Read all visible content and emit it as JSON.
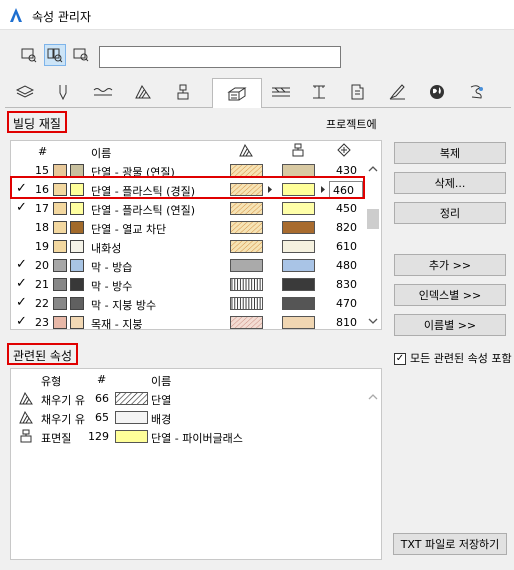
{
  "window": {
    "title": "속성 관리자"
  },
  "search": {
    "value": ""
  },
  "section1": {
    "label": "빌딩 재질",
    "right_label": "프로젝트에"
  },
  "list_headers": {
    "num": "#",
    "name": "이름"
  },
  "materials": [
    {
      "num": "15",
      "name": "단열 - 광물 (연질)",
      "checked": false,
      "sw1": "#e8c99a",
      "sw2": "#c8c09e",
      "pattern": "hatch-orange",
      "color": "#d8c9a2",
      "value": "430"
    },
    {
      "num": "16",
      "name": "단열 - 플라스틱 (경질)",
      "checked": true,
      "sw1": "#f3d8a0",
      "sw2": "#ffff99",
      "pattern": "hatch-orange",
      "color": "#ffff99",
      "value": "460",
      "selected": true
    },
    {
      "num": "17",
      "name": "단열 - 플라스틱 (연질)",
      "checked": true,
      "sw1": "#f3d8a0",
      "sw2": "#ffffa0",
      "pattern": "hatch-orange",
      "color": "#ffffa8",
      "value": "450"
    },
    {
      "num": "18",
      "name": "단열 - 열교 차단",
      "checked": false,
      "sw1": "#f3d8a0",
      "sw2": "#a26a2a",
      "pattern": "hatch-orange",
      "color": "#a86b2e",
      "value": "820"
    },
    {
      "num": "19",
      "name": "내화성",
      "checked": false,
      "sw1": "#f3d8a0",
      "sw2": "#f5f3e8",
      "pattern": "hatch-orange",
      "color": "#f5f1df",
      "value": "610"
    },
    {
      "num": "20",
      "name": "막 - 방습",
      "checked": true,
      "sw1": "#a8a8a8",
      "sw2": "#a8c4e4",
      "pattern": "solid-gray",
      "color": "#a9c4e6",
      "value": "480"
    },
    {
      "num": "21",
      "name": "막 - 방수",
      "checked": true,
      "sw1": "#888888",
      "sw2": "#383838",
      "pattern": "vlines",
      "color": "#3a3a3a",
      "value": "830"
    },
    {
      "num": "22",
      "name": "막 - 지붕 방수",
      "checked": true,
      "sw1": "#888888",
      "sw2": "#606060",
      "pattern": "vlines",
      "color": "#555555",
      "value": "470"
    },
    {
      "num": "23",
      "name": "목재 - 지붕",
      "checked": true,
      "sw1": "#e8b8a8",
      "sw2": "#f2d8b4",
      "pattern": "hatch-pink",
      "color": "#f0d6b2",
      "value": "810"
    }
  ],
  "buttons": {
    "duplicate": "복제",
    "delete": "삭제...",
    "cleanup": "정리",
    "add": "추가 >>",
    "by_index": "인덱스별 >>",
    "by_name": "이름별 >>",
    "save_txt": "TXT 파일로 저장하기"
  },
  "section2": {
    "label": "관련된 속성",
    "checkbox_label": "모든 관련된 속성 포함",
    "checkbox_checked": true
  },
  "related_headers": {
    "type": "유형",
    "num": "#",
    "name": "이름"
  },
  "related": [
    {
      "type": "채우기 유",
      "num": "66",
      "name": "단열",
      "icon": "fill-icon",
      "swatch": "hatch"
    },
    {
      "type": "채우기 유",
      "num": "65",
      "name": "배경",
      "icon": "fill-icon",
      "swatch": "#f4f4f4"
    },
    {
      "type": "표면질",
      "num": "129",
      "name": "단열 - 파이버글래스",
      "icon": "surface-icon",
      "swatch": "#ffff99"
    }
  ]
}
